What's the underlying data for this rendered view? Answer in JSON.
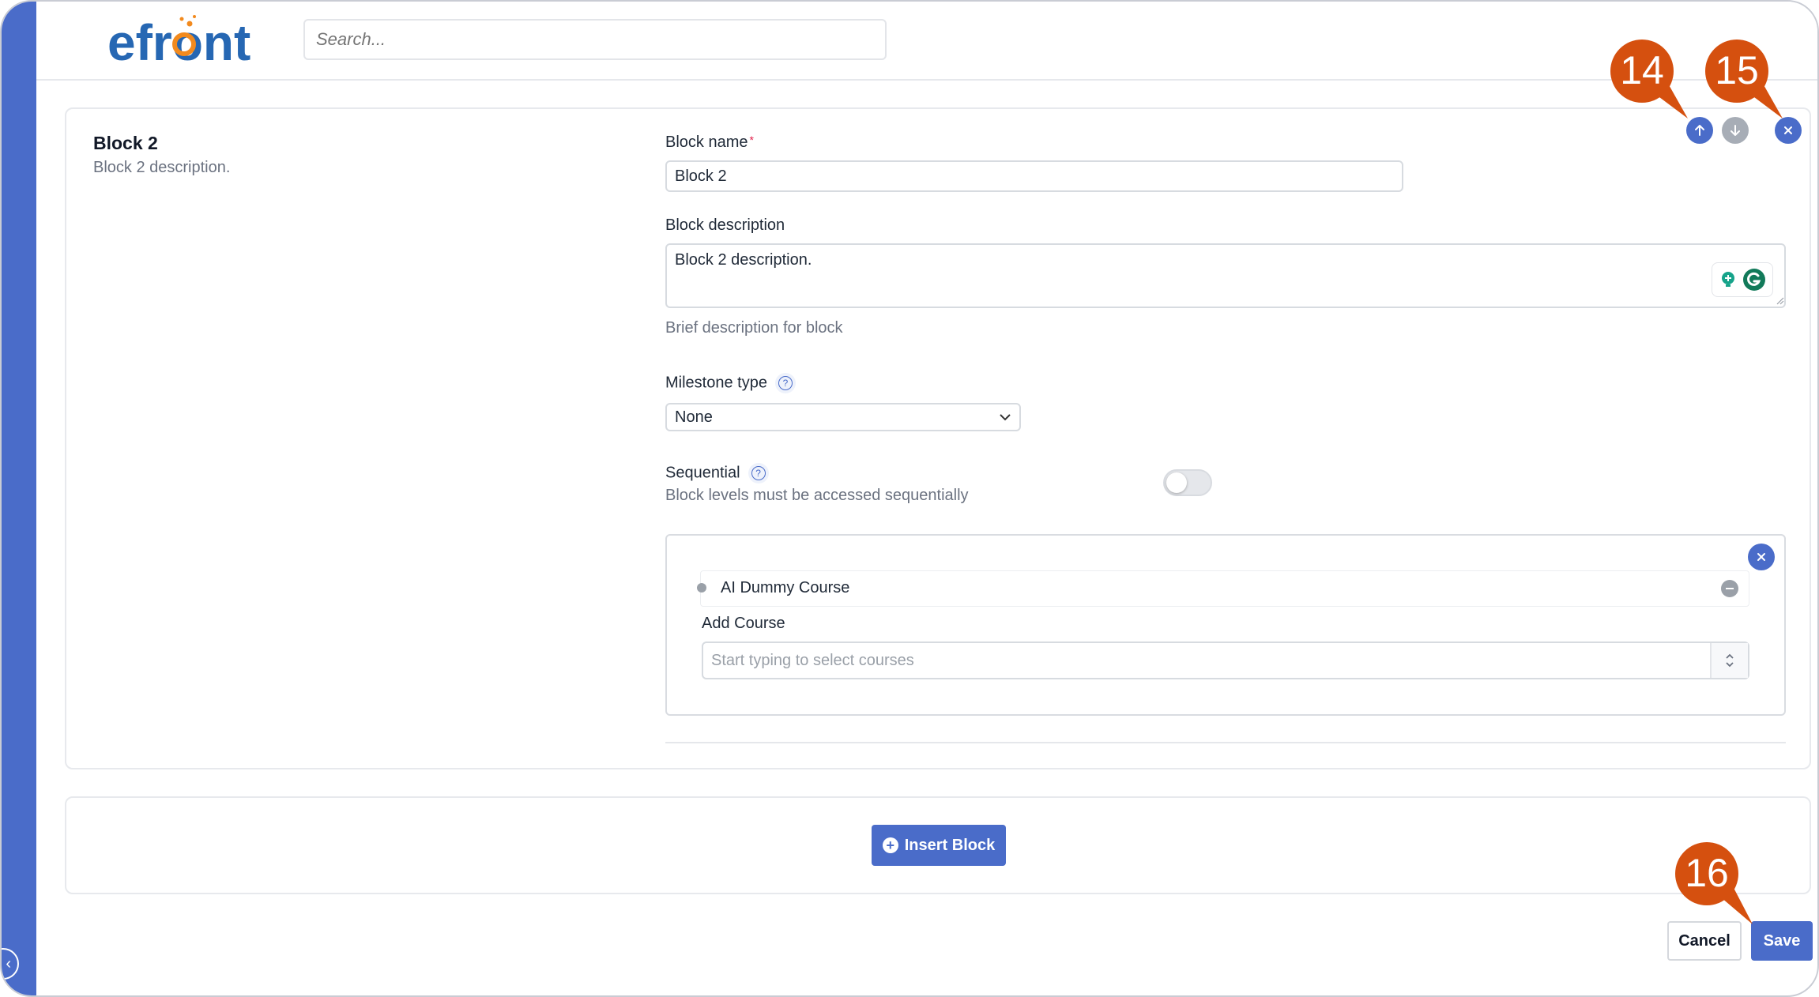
{
  "app": {
    "logo_text": "efront",
    "search_placeholder": "Search..."
  },
  "block": {
    "title": "Block 2",
    "subtitle": "Block 2 description."
  },
  "form": {
    "name_label": "Block name",
    "name_required_mark": "*",
    "name_value": "Block 2",
    "description_label": "Block description",
    "description_value": "Block 2 description.",
    "description_hint": "Brief description for block",
    "milestone_label": "Milestone type",
    "milestone_value": "None",
    "sequential_label": "Sequential",
    "sequential_hint": "Block levels must be accessed sequentially",
    "sequential_on": false
  },
  "courses": {
    "items": [
      {
        "label": "AI Dummy Course"
      }
    ],
    "add_label": "Add Course",
    "add_placeholder": "Start typing to select courses"
  },
  "actions": {
    "insert_block": "Insert Block",
    "cancel": "Cancel",
    "save": "Save"
  },
  "callouts": {
    "c14": "14",
    "c15": "15",
    "c16": "16"
  },
  "colors": {
    "accent": "#4a6cc9",
    "callout": "#d5500f",
    "logo_blue": "#2667b3",
    "logo_orange": "#f28a1e"
  },
  "icons": {
    "bell": "bell-icon",
    "move_up": "arrow-up-icon",
    "move_down": "arrow-down-icon",
    "remove": "close-icon",
    "help": "question-icon",
    "select": "chevron-down-icon"
  }
}
